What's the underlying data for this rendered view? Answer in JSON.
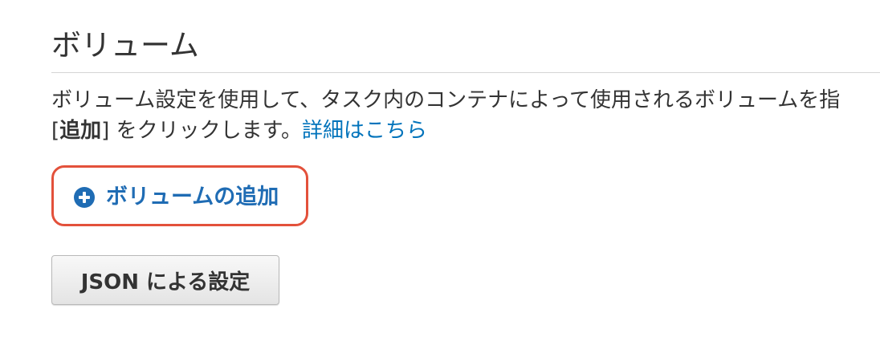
{
  "section": {
    "title": "ボリューム"
  },
  "description": {
    "line1": "ボリューム設定を使用して、タスク内のコンテナによって使用されるボリュームを指",
    "line2_bold": "追加",
    "line2_open": "[",
    "line2_close": "]",
    "line2_text": " をクリックします。",
    "link_text": "詳細はこちら"
  },
  "add_volume": {
    "label": "ボリュームの追加",
    "icon": "plus-circle-icon",
    "highlight_color": "#e3513b",
    "color": "#1f6cb4"
  },
  "json_button": {
    "label": "JSON による設定"
  },
  "colors": {
    "link": "#0073bb",
    "text": "#333333"
  }
}
